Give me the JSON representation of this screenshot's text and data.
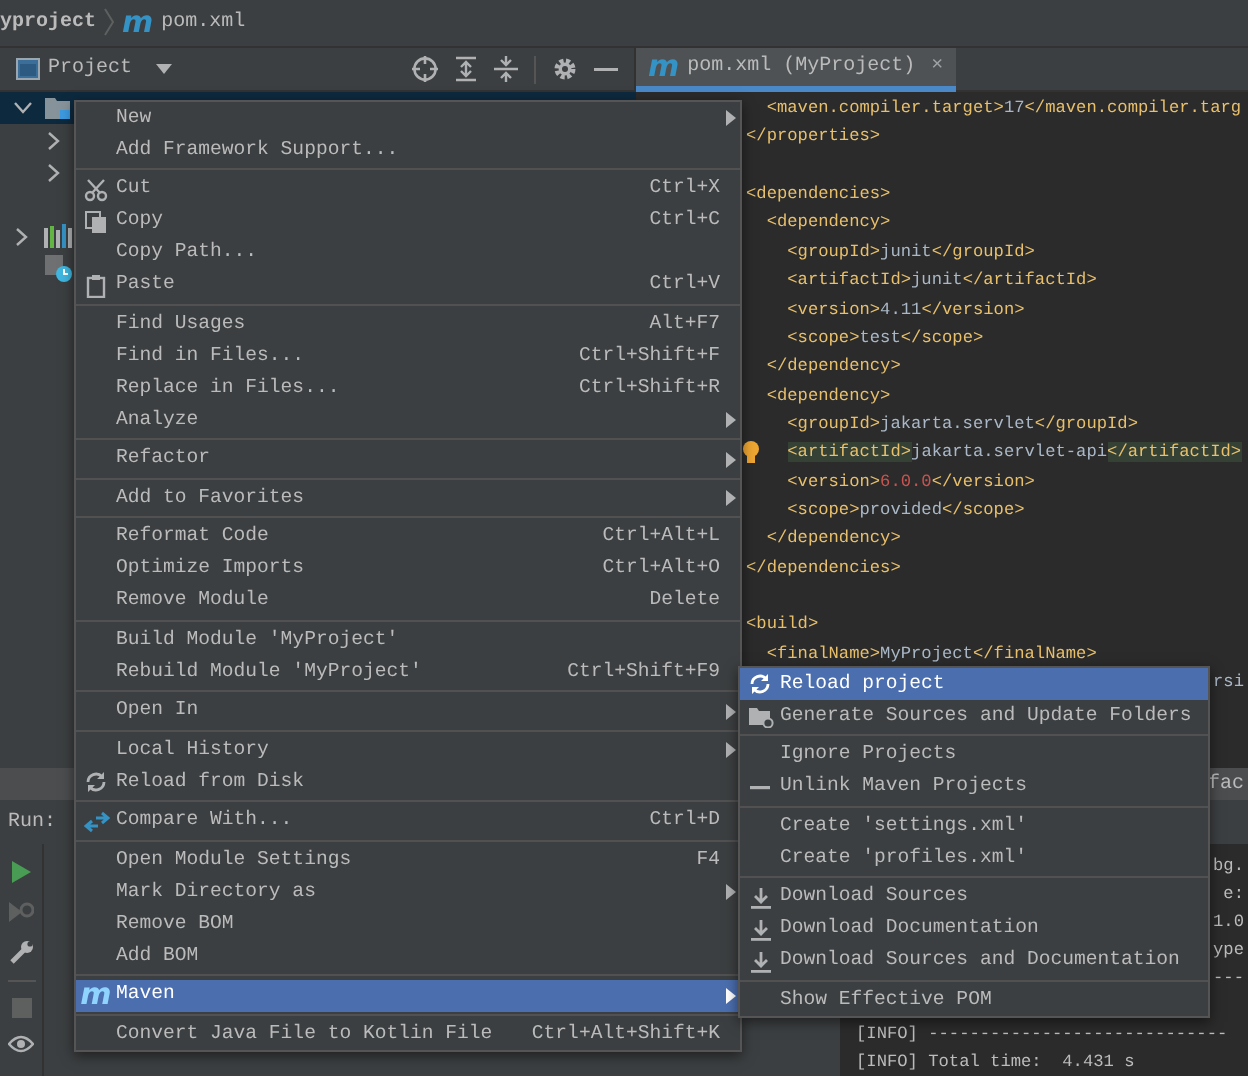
{
  "breadcrumb": {
    "project": "yproject",
    "file_icon": "m",
    "file": "pom.xml"
  },
  "project_panel": {
    "title": "Project"
  },
  "tabs": [
    {
      "icon": "m",
      "label": "pom.xml (MyProject)",
      "close": "×",
      "selected": true
    }
  ],
  "tree": [
    {
      "kind": "module",
      "expanded": true,
      "selected": true,
      "children": [
        {
          "expanded": false,
          "selected": false
        },
        {
          "expanded": false,
          "selected": false
        }
      ]
    },
    {
      "kind": "libraries",
      "expanded": false,
      "selected": false
    },
    {
      "kind": "scratches",
      "selected": false
    }
  ],
  "editor": {
    "lines": [
      {
        "kind": "code",
        "tokens": [
          {
            "kind": "tag",
            "text": "  <maven.compiler.target>"
          },
          {
            "kind": "text",
            "text": "17"
          },
          {
            "kind": "tag",
            "text": "</maven.compiler.targ"
          }
        ]
      },
      {
        "kind": "code",
        "tokens": [
          {
            "kind": "tag",
            "text": "</properties>"
          }
        ]
      },
      {
        "kind": "blank"
      },
      {
        "kind": "code",
        "tokens": [
          {
            "kind": "tag",
            "text": "<dependencies>"
          }
        ]
      },
      {
        "kind": "code",
        "tokens": [
          {
            "kind": "tag",
            "text": "  <dependency>"
          }
        ]
      },
      {
        "kind": "code",
        "tokens": [
          {
            "kind": "tag",
            "text": "    <groupId>"
          },
          {
            "kind": "text",
            "text": "junit"
          },
          {
            "kind": "tag",
            "text": "</groupId>"
          }
        ]
      },
      {
        "kind": "code",
        "tokens": [
          {
            "kind": "tag",
            "text": "    <artifactId>"
          },
          {
            "kind": "text",
            "text": "junit"
          },
          {
            "kind": "tag",
            "text": "</artifactId>"
          }
        ]
      },
      {
        "kind": "code",
        "tokens": [
          {
            "kind": "tag",
            "text": "    <version>"
          },
          {
            "kind": "text",
            "text": "4.11"
          },
          {
            "kind": "tag",
            "text": "</version>"
          }
        ]
      },
      {
        "kind": "code",
        "tokens": [
          {
            "kind": "tag",
            "text": "    <scope>"
          },
          {
            "kind": "text",
            "text": "test"
          },
          {
            "kind": "tag",
            "text": "</scope>"
          }
        ]
      },
      {
        "kind": "code",
        "tokens": [
          {
            "kind": "tag",
            "text": "  </dependency>"
          }
        ]
      },
      {
        "kind": "code",
        "tokens": [
          {
            "kind": "tag",
            "text": "  <dependency>"
          }
        ]
      },
      {
        "kind": "code",
        "tokens": [
          {
            "kind": "tag",
            "text": "    <groupId>"
          },
          {
            "kind": "text",
            "text": "jakarta.servlet"
          },
          {
            "kind": "tag",
            "text": "</groupId>"
          }
        ]
      },
      {
        "kind": "code",
        "bulb": true,
        "tokens": [
          {
            "kind": "match",
            "text": "    <artifactId>"
          },
          {
            "kind": "text",
            "text": "jakarta.servlet-api"
          },
          {
            "kind": "match",
            "text": "</artifactId>"
          }
        ]
      },
      {
        "kind": "code",
        "tokens": [
          {
            "kind": "tag",
            "text": "    <version>"
          },
          {
            "kind": "error",
            "text": "6.0.0"
          },
          {
            "kind": "tag",
            "text": "</version>"
          }
        ]
      },
      {
        "kind": "code",
        "tokens": [
          {
            "kind": "tag",
            "text": "    <scope>"
          },
          {
            "kind": "text",
            "text": "provided"
          },
          {
            "kind": "tag",
            "text": "</scope>"
          }
        ]
      },
      {
        "kind": "code",
        "tokens": [
          {
            "kind": "tag",
            "text": "  </dependency>"
          }
        ]
      },
      {
        "kind": "code",
        "tokens": [
          {
            "kind": "tag",
            "text": "</dependencies>"
          }
        ]
      },
      {
        "kind": "blank"
      },
      {
        "kind": "code",
        "tokens": [
          {
            "kind": "tag",
            "text": "<build>"
          }
        ]
      },
      {
        "kind": "code",
        "tokens": [
          {
            "kind": "tag",
            "text": "  <finalName>"
          },
          {
            "kind": "text",
            "text": "MyProject"
          },
          {
            "kind": "tag",
            "text": "</finalName>"
          }
        ]
      },
      {
        "kind": "tail",
        "text": "rsi"
      }
    ]
  },
  "run_panel": {
    "header_tail": "fac",
    "label": "Run:",
    "tools": [
      {
        "kind": "run",
        "disabled": false
      },
      {
        "kind": "rerun",
        "disabled": true
      },
      {
        "kind": "settings",
        "disabled": false
      },
      {
        "kind": "stop",
        "disabled": true
      },
      {
        "kind": "view",
        "disabled": false
      }
    ],
    "console": [
      {
        "kind": "tail",
        "text": "bg."
      },
      {
        "kind": "tail",
        "text": "e:"
      },
      {
        "kind": "tail",
        "text": "1.0"
      },
      {
        "kind": "tail",
        "text": "ype"
      },
      {
        "kind": "tail",
        "text": "---"
      },
      {
        "kind": "blank"
      },
      {
        "kind": "line",
        "text": "[INFO] -----------------------------"
      },
      {
        "kind": "line",
        "text": "[INFO] Total time:  4.431 s"
      }
    ]
  },
  "context_menu": {
    "groups": [
      {
        "items": [
          {
            "label": "New",
            "submenu": true,
            "selected": false
          },
          {
            "label": "Add Framework Support...",
            "selected": false
          }
        ]
      },
      {
        "items": [
          {
            "label": "Cut",
            "kind": "cut",
            "shortcut": "Ctrl+X",
            "selected": false
          },
          {
            "label": "Copy",
            "kind": "copy",
            "shortcut": "Ctrl+C",
            "selected": false
          },
          {
            "label": "Copy Path...",
            "selected": false
          },
          {
            "label": "Paste",
            "kind": "paste",
            "shortcut": "Ctrl+V",
            "selected": false
          }
        ]
      },
      {
        "items": [
          {
            "label": "Find Usages",
            "shortcut": "Alt+F7",
            "selected": false
          },
          {
            "label": "Find in Files...",
            "shortcut": "Ctrl+Shift+F",
            "selected": false
          },
          {
            "label": "Replace in Files...",
            "shortcut": "Ctrl+Shift+R",
            "selected": false
          },
          {
            "label": "Analyze",
            "submenu": true,
            "selected": false
          }
        ]
      },
      {
        "items": [
          {
            "label": "Refactor",
            "submenu": true,
            "selected": false
          }
        ]
      },
      {
        "items": [
          {
            "label": "Add to Favorites",
            "submenu": true,
            "selected": false
          }
        ]
      },
      {
        "items": [
          {
            "label": "Reformat Code",
            "shortcut": "Ctrl+Alt+L",
            "selected": false
          },
          {
            "label": "Optimize Imports",
            "shortcut": "Ctrl+Alt+O",
            "selected": false
          },
          {
            "label": "Remove Module",
            "shortcut": "Delete",
            "selected": false
          }
        ]
      },
      {
        "items": [
          {
            "label": "Build Module 'MyProject'",
            "selected": false
          },
          {
            "label": "Rebuild Module 'MyProject'",
            "shortcut": "Ctrl+Shift+F9",
            "selected": false
          }
        ]
      },
      {
        "items": [
          {
            "label": "Open In",
            "submenu": true,
            "selected": false
          }
        ]
      },
      {
        "items": [
          {
            "label": "Local History",
            "submenu": true,
            "selected": false
          },
          {
            "label": "Reload from Disk",
            "kind": "reload",
            "selected": false
          }
        ]
      },
      {
        "items": [
          {
            "label": "Compare With...",
            "kind": "compare",
            "shortcut": "Ctrl+D",
            "selected": false
          }
        ]
      },
      {
        "items": [
          {
            "label": "Open Module Settings",
            "shortcut": "F4",
            "selected": false
          },
          {
            "label": "Mark Directory as",
            "submenu": true,
            "selected": false
          },
          {
            "label": "Remove BOM",
            "selected": false
          },
          {
            "label": "Add BOM",
            "selected": false
          }
        ]
      },
      {
        "items": [
          {
            "label": "Maven",
            "kind": "maven",
            "icon_text": "m",
            "submenu": true,
            "selected": true
          }
        ]
      },
      {
        "items": [
          {
            "label": "Convert Java File to Kotlin File",
            "shortcut": "Ctrl+Alt+Shift+K",
            "selected": false
          }
        ]
      }
    ]
  },
  "maven_submenu": {
    "groups": [
      {
        "items": [
          {
            "label": "Reload project",
            "kind": "reload",
            "selected": true
          },
          {
            "label": "Generate Sources and Update Folders",
            "kind": "folder-sync",
            "selected": false
          }
        ]
      },
      {
        "items": [
          {
            "label": "Ignore Projects",
            "selected": false
          },
          {
            "label": "Unlink Maven Projects",
            "kind": "unlink",
            "selected": false
          }
        ]
      },
      {
        "items": [
          {
            "label": "Create 'settings.xml'",
            "selected": false
          },
          {
            "label": "Create 'profiles.xml'",
            "selected": false
          }
        ]
      },
      {
        "items": [
          {
            "label": "Download Sources",
            "kind": "download",
            "selected": false
          },
          {
            "label": "Download Documentation",
            "kind": "download",
            "selected": false
          },
          {
            "label": "Download Sources and Documentation",
            "kind": "download",
            "selected": false
          }
        ]
      },
      {
        "items": [
          {
            "label": "Show Effective POM",
            "selected": false
          }
        ]
      }
    ]
  }
}
